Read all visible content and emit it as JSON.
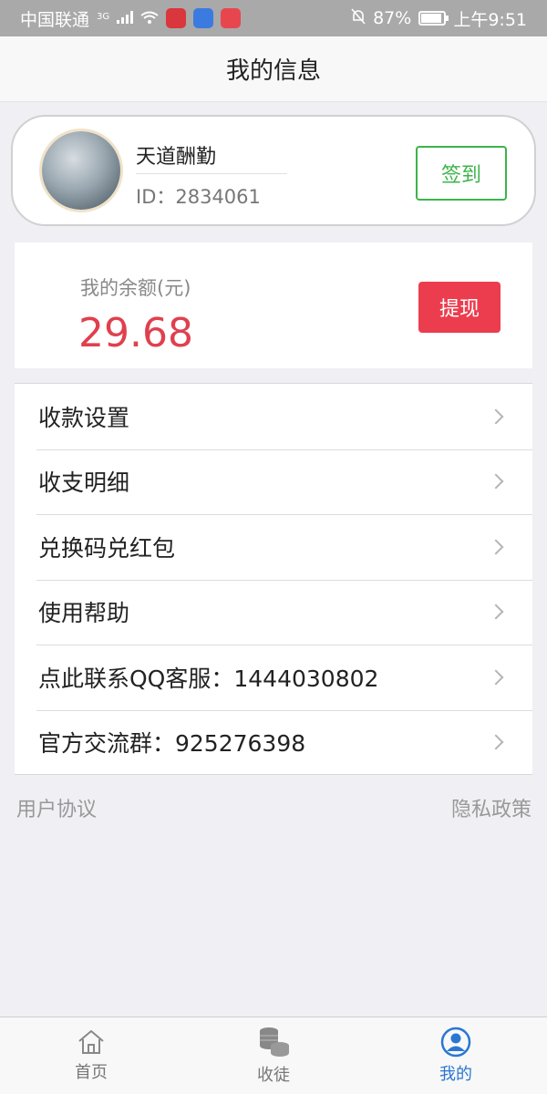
{
  "status_bar": {
    "carrier": "中国联通",
    "network": "3G",
    "battery": "87%",
    "time": "上午9:51"
  },
  "header": {
    "title": "我的信息"
  },
  "profile": {
    "name": "天道酬勤",
    "id_text": "ID：2834061",
    "checkin_label": "签到"
  },
  "balance": {
    "label": "我的余额(元)",
    "value": "29.68",
    "withdraw_label": "提现"
  },
  "menu": {
    "items": [
      {
        "label": "收款设置"
      },
      {
        "label": "收支明细"
      },
      {
        "label": "兑换码兑红包"
      },
      {
        "label": "使用帮助"
      },
      {
        "label": "点此联系QQ客服：1444030802"
      },
      {
        "label": "官方交流群：925276398"
      }
    ]
  },
  "links": {
    "user_agreement": "用户协议",
    "privacy_policy": "隐私政策"
  },
  "tabbar": {
    "items": [
      {
        "label": "首页",
        "icon": "home-icon",
        "active": false
      },
      {
        "label": "收徒",
        "icon": "coins-icon",
        "active": false
      },
      {
        "label": "我的",
        "icon": "user-icon",
        "active": true
      }
    ]
  },
  "colors": {
    "accent_green": "#3cb44a",
    "accent_red": "#ec3d4e",
    "active_tab": "#2a77d2"
  }
}
